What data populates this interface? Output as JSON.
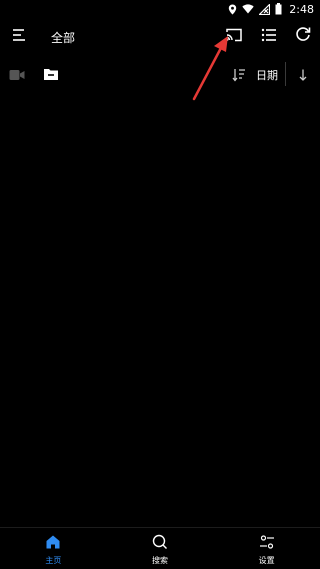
{
  "status_bar": {
    "time": "2:48",
    "icons": [
      "location-icon",
      "wifi-icon",
      "no-signal-icon",
      "battery-icon"
    ]
  },
  "app_bar": {
    "title": "全部",
    "icons": [
      "menu-icon",
      "cast-icon",
      "list-view-icon",
      "refresh-icon"
    ]
  },
  "filters": {
    "icons": [
      "video-icon",
      "folder-icon"
    ],
    "sort_label": "日期",
    "sort_icon": "sort-icon",
    "order_icon": "arrow-down-icon"
  },
  "bottom_nav": {
    "items": [
      {
        "label": "主页",
        "icon": "home-icon",
        "active": true
      },
      {
        "label": "搜索",
        "icon": "search-icon",
        "active": false
      },
      {
        "label": "设置",
        "icon": "settings-icon",
        "active": false
      }
    ]
  },
  "colors": {
    "background": "#000000",
    "foreground": "#ffffff",
    "accent": "#2f8cf2",
    "annotation": "#e53935"
  }
}
